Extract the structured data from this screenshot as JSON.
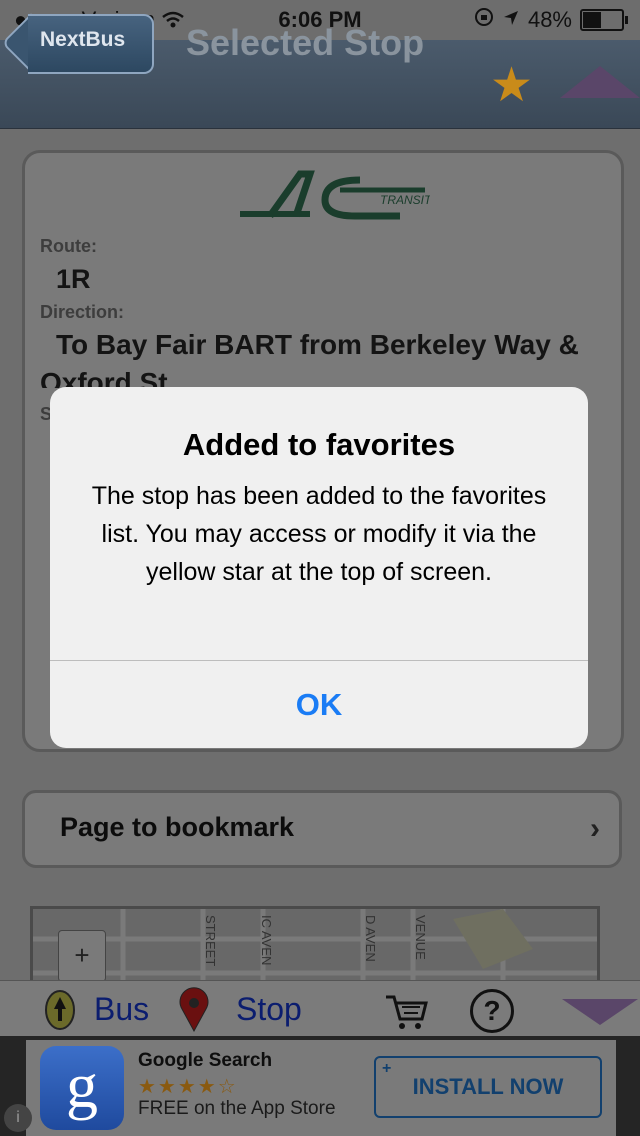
{
  "status_bar": {
    "carrier": "Verizon",
    "time": "6:06 PM",
    "battery": "48%",
    "signal_dots": "●○○○○"
  },
  "nav": {
    "back_label": "NextBus",
    "title": "Selected Stop"
  },
  "card": {
    "logo_text": "TRANSIT",
    "route_label": "Route:",
    "route_value": "1R",
    "direction_label": "Direction:",
    "direction_value": "To Bay Fair BART from Berkeley Way & Oxford St",
    "stop_label_partial": "S"
  },
  "bookmark": {
    "label": "Page to bookmark"
  },
  "map": {
    "zoom_in": "+",
    "street_labels": [
      "STREET",
      "IC AVEN",
      "D AVEN",
      "VENUE"
    ]
  },
  "toolbar": {
    "bus_label": "Bus",
    "stop_label": "Stop",
    "help_symbol": "?"
  },
  "ad": {
    "app_name": "Google Search",
    "rating_stars": "★★★★☆",
    "subtitle": "FREE on the App Store",
    "install_label": "INSTALL NOW",
    "icon_letter": "g",
    "info_symbol": "i"
  },
  "alert": {
    "title": "Added to favorites",
    "message": "The stop has been added to the favorites list. You may access or modify it via the yellow star at the top of screen.",
    "ok_label": "OK"
  },
  "colors": {
    "alert_button": "#1a7cf5",
    "favorite_star": "#f3a427"
  }
}
